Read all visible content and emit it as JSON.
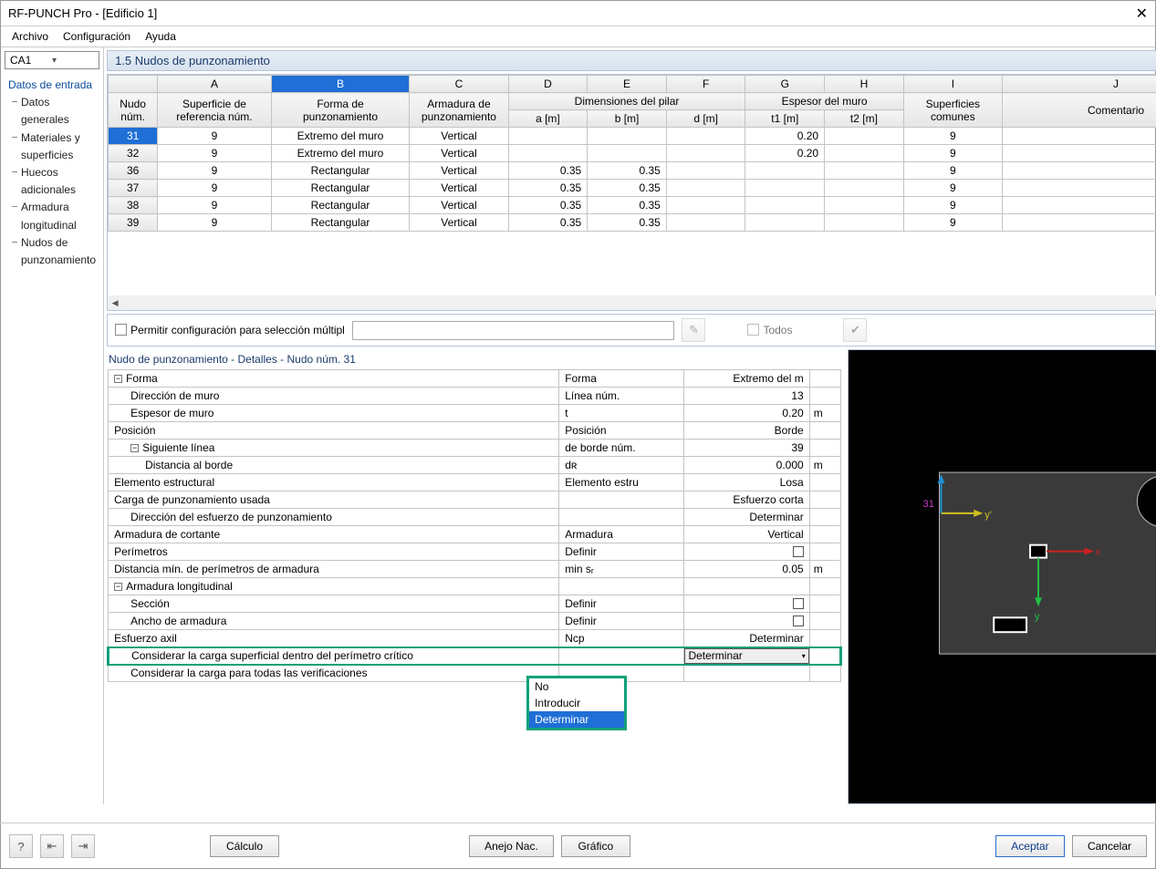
{
  "window": {
    "title": "RF-PUNCH Pro - [Edificio 1]"
  },
  "menu": {
    "file": "Archivo",
    "config": "Configuración",
    "help": "Ayuda"
  },
  "combo": {
    "value": "CA1"
  },
  "tree": {
    "root": "Datos de entrada",
    "items": [
      "Datos generales",
      "Materiales y superficies",
      "Huecos adicionales",
      "Armadura longitudinal",
      "Nudos de punzonamiento"
    ]
  },
  "section_title": "1.5 Nudos de punzonamiento",
  "col_letters": [
    "A",
    "B",
    "C",
    "D",
    "E",
    "F",
    "G",
    "H",
    "I",
    "J"
  ],
  "headers": {
    "nudo": "Nudo\nnúm.",
    "sup_ref": "Superficie de\nreferencia núm.",
    "forma": "Forma de\npunzonamiento",
    "arm": "Armadura de\npunzonamiento",
    "dim_group": "Dimensiones del pilar",
    "a": "a [m]",
    "b": "b [m]",
    "d": "d [m]",
    "esp_group": "Espesor del muro",
    "t1": "t1 [m]",
    "t2": "t2 [m]",
    "supcom": "Superficies\ncomunes",
    "coment": "Comentario"
  },
  "rows": [
    {
      "num": "31",
      "sup": "9",
      "forma": "Extremo del muro",
      "arm": "Vertical",
      "a": "",
      "b": "",
      "d": "",
      "t1": "0.20",
      "t2": "",
      "supcom": "9",
      "sel": true
    },
    {
      "num": "32",
      "sup": "9",
      "forma": "Extremo del muro",
      "arm": "Vertical",
      "a": "",
      "b": "",
      "d": "",
      "t1": "0.20",
      "t2": "",
      "supcom": "9"
    },
    {
      "num": "36",
      "sup": "9",
      "forma": "Rectangular",
      "arm": "Vertical",
      "a": "0.35",
      "b": "0.35",
      "d": "",
      "t1": "",
      "t2": "",
      "supcom": "9"
    },
    {
      "num": "37",
      "sup": "9",
      "forma": "Rectangular",
      "arm": "Vertical",
      "a": "0.35",
      "b": "0.35",
      "d": "",
      "t1": "",
      "t2": "",
      "supcom": "9"
    },
    {
      "num": "38",
      "sup": "9",
      "forma": "Rectangular",
      "arm": "Vertical",
      "a": "0.35",
      "b": "0.35",
      "d": "",
      "t1": "",
      "t2": "",
      "supcom": "9"
    },
    {
      "num": "39",
      "sup": "9",
      "forma": "Rectangular",
      "arm": "Vertical",
      "a": "0.35",
      "b": "0.35",
      "d": "",
      "t1": "",
      "t2": "",
      "supcom": "9"
    }
  ],
  "options": {
    "multi": "Permitir configuración para selección múltipl",
    "todos": "Todos"
  },
  "details_title": "Nudo de punzonamiento - Detalles - Nudo núm.  31",
  "details": [
    {
      "t": "group",
      "l": "Forma",
      "m": "Forma",
      "v": "Extremo del m",
      "u": ""
    },
    {
      "t": "row",
      "l": "Dirección de muro",
      "m": "Línea núm.",
      "v": "13",
      "u": "",
      "ind": 1
    },
    {
      "t": "row",
      "l": "Espesor de muro",
      "m": "t",
      "v": "0.20",
      "u": "m",
      "ind": 1
    },
    {
      "t": "row",
      "l": "Posición",
      "m": "Posición",
      "v": "Borde",
      "u": ""
    },
    {
      "t": "group",
      "l": "Siguiente línea",
      "m": "de borde núm.",
      "v": "39",
      "u": "",
      "ind": 1
    },
    {
      "t": "row",
      "l": "Distancia al borde",
      "m": "dʀ",
      "v": "0.000",
      "u": "m",
      "ind": 2
    },
    {
      "t": "row",
      "l": "Elemento estructural",
      "m": "Elemento estru",
      "v": "Losa",
      "u": ""
    },
    {
      "t": "row",
      "l": "Carga de punzonamiento usada",
      "m": "",
      "v": "Esfuerzo corta",
      "u": ""
    },
    {
      "t": "row",
      "l": "Dirección del esfuerzo de punzonamiento",
      "m": "",
      "v": "Determinar",
      "u": "",
      "ind": 1
    },
    {
      "t": "row",
      "l": "Armadura de cortante",
      "m": "Armadura",
      "v": "Vertical",
      "u": ""
    },
    {
      "t": "row",
      "l": "Perímetros",
      "m": "Definir",
      "v": "[chk]",
      "u": ""
    },
    {
      "t": "row",
      "l": "Distancia mín. de perímetros de armadura",
      "m": "min sᵣ",
      "v": "0.05",
      "u": "m"
    },
    {
      "t": "group",
      "l": "Armadura longitudinal",
      "m": "",
      "v": "",
      "u": ""
    },
    {
      "t": "row",
      "l": "Sección",
      "m": "Definir",
      "v": "[chk]",
      "u": "",
      "ind": 1
    },
    {
      "t": "row",
      "l": "Ancho de armadura",
      "m": "Definir",
      "v": "[chk]",
      "u": "",
      "ind": 1
    },
    {
      "t": "row",
      "l": "Esfuerzo axil",
      "m": "Ncp",
      "v": "Determinar",
      "u": ""
    },
    {
      "t": "hl",
      "l": "Considerar la carga superficial dentro del perímetro crítico",
      "m": "",
      "v": "[dd]",
      "u": "",
      "ind": 1
    },
    {
      "t": "row",
      "l": "Considerar la carga para todas las verificaciones",
      "m": "",
      "v": "",
      "u": "",
      "ind": 1
    }
  ],
  "dropdown": {
    "current": "Determinar",
    "items": [
      "No",
      "Introducir",
      "Determinar"
    ],
    "selected": "Determinar"
  },
  "preview": {
    "node_label": "31",
    "y": "y'",
    "x": "x",
    "yaxis": "y"
  },
  "buttons": {
    "calculo": "Cálculo",
    "anejo": "Anejo Nac.",
    "grafico": "Gráfico",
    "aceptar": "Aceptar",
    "cancelar": "Cancelar"
  }
}
